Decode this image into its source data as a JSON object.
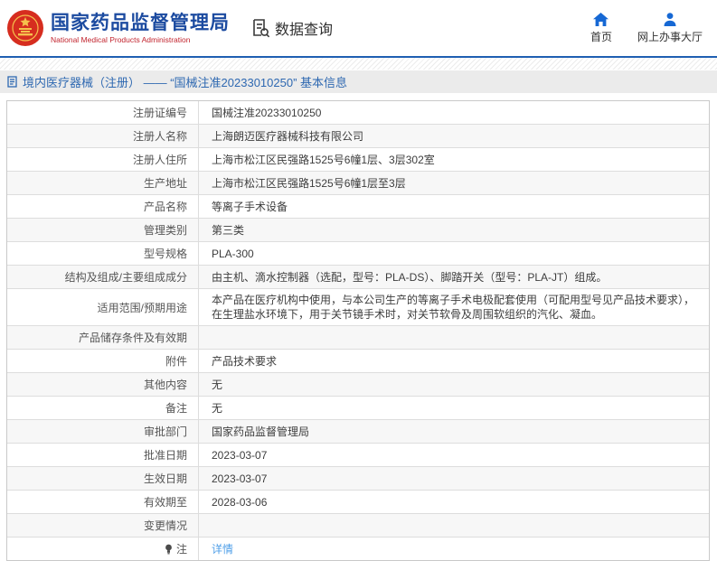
{
  "header": {
    "agency_cn": "国家药品监督管理局",
    "agency_en": "National Medical Products Administration",
    "data_query_label": "数据查询",
    "nav_home_label": "首页",
    "nav_hall_label": "网上办事大厅"
  },
  "title_bar": {
    "text": "境内医疗器械（注册） ——  “国械注准20233010250”  基本信息"
  },
  "table": {
    "rows": [
      {
        "label": "注册证编号",
        "value": "国械注准20233010250"
      },
      {
        "label": "注册人名称",
        "value": "上海朗迈医疗器械科技有限公司"
      },
      {
        "label": "注册人住所",
        "value": "上海市松江区民强路1525号6幢1层、3层302室"
      },
      {
        "label": "生产地址",
        "value": "上海市松江区民强路1525号6幢1层至3层"
      },
      {
        "label": "产品名称",
        "value": "等离子手术设备"
      },
      {
        "label": "管理类别",
        "value": "第三类"
      },
      {
        "label": "型号规格",
        "value": "PLA-300"
      },
      {
        "label": "结构及组成/主要组成成分",
        "value": "由主机、滴水控制器（选配，型号：PLA-DS）、脚踏开关（型号：PLA-JT）组成。"
      },
      {
        "label": "适用范围/预期用途",
        "value": "本产品在医疗机构中使用，与本公司生产的等离子手术电极配套使用（可配用型号见产品技术要求），在生理盐水环境下，用于关节镜手术时，对关节软骨及周围软组织的汽化、凝血。"
      },
      {
        "label": "产品储存条件及有效期",
        "value": ""
      },
      {
        "label": "附件",
        "value": "产品技术要求"
      },
      {
        "label": "其他内容",
        "value": "无"
      },
      {
        "label": "备注",
        "value": "无"
      },
      {
        "label": "审批部门",
        "value": "国家药品监督管理局"
      },
      {
        "label": "批准日期",
        "value": "2023-03-07"
      },
      {
        "label": "生效日期",
        "value": "2023-03-07"
      },
      {
        "label": "有效期至",
        "value": "2028-03-06"
      },
      {
        "label": "变更情况",
        "value": ""
      },
      {
        "label": "注",
        "value": "详情",
        "icon": "bulb-icon",
        "link": true
      }
    ]
  },
  "colors": {
    "brand_blue": "#1c4ba0",
    "brand_red": "#c2242e",
    "nav_icon_blue": "#1668d4",
    "divider_blue": "#1f5fb2",
    "title_bar_bg": "#ebebeb",
    "title_text_blue": "#2e68b1",
    "row_alt_bg": "#f7f7f7",
    "link_blue": "#4f9fe8",
    "emblem_red": "#d62d1f",
    "emblem_gold": "#f5c14d"
  }
}
